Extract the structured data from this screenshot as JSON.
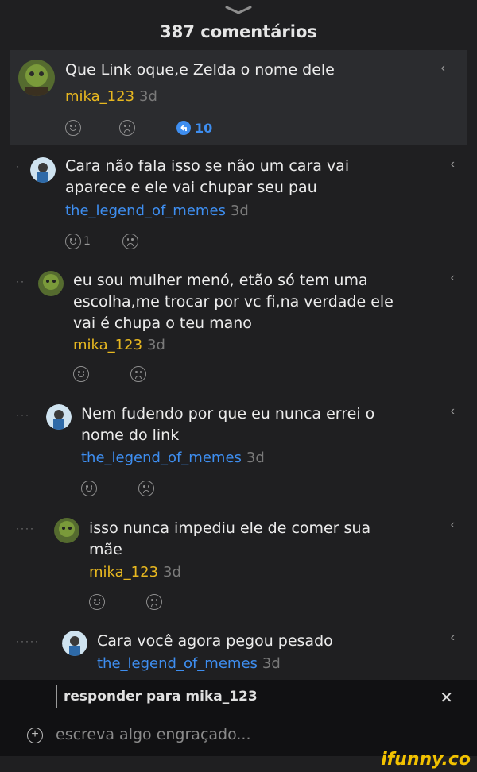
{
  "header": {
    "title": "387 comentários"
  },
  "comments": [
    {
      "text": "Que Link oque,e Zelda o nome dele",
      "user": "mika_123",
      "age": "3d",
      "replies": "10",
      "depth": ""
    },
    {
      "text": "Cara não fala isso se não um cara vai aparece e ele vai chupar seu pau",
      "user": "the_legend_of_memes",
      "age": "3d",
      "likes": "1",
      "depth": "·"
    },
    {
      "text": "eu sou mulher menó, etão só tem uma escolha,me trocar por vc fi,na verdade ele vai é chupa o teu mano",
      "user": "mika_123",
      "age": "3d",
      "depth": "··"
    },
    {
      "text": "Nem fudendo por que eu nunca errei o nome do link",
      "user": "the_legend_of_memes",
      "age": "3d",
      "depth": "···"
    },
    {
      "text": "isso nunca impediu ele de comer sua mãe",
      "user": "mika_123",
      "age": "3d",
      "depth": "····"
    },
    {
      "text": "Cara você agora pegou pesado",
      "user": "the_legend_of_memes",
      "age": "3d",
      "depth": "·····"
    }
  ],
  "composer": {
    "reply_to": "responder para mika_123",
    "placeholder": "escreva algo engraçado..."
  },
  "watermark": "ifunny.co",
  "colors": {
    "background": "#1f1f21",
    "username_yellow": "#e8b820",
    "username_blue": "#3e8ef0",
    "accent": "#3e8ef0"
  },
  "icons": [
    "chevron-down-icon",
    "reply-arrow-icon",
    "smile-icon",
    "frown-icon",
    "replies-bubble-icon",
    "close-icon",
    "add-icon"
  ]
}
